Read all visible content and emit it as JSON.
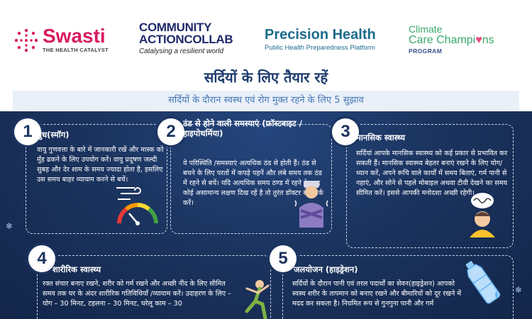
{
  "logos": {
    "swasti": {
      "name": "Swasti",
      "tagline": "THE HEALTH CATALYST"
    },
    "community_action_collab": {
      "line1": "COMMUNITY",
      "line2": "ACTIONCOLLAB",
      "tagline": "Catalysing a resilient world"
    },
    "precision_health": {
      "name": "Precision Health",
      "tagline": "Public Health Preparedness Platform"
    },
    "climate_care_champions": {
      "line1": "Climate",
      "line2a": "Care Champi",
      "line2b": "ns",
      "line3": "PROGRAM"
    }
  },
  "title": "सर्दियों के लिए तैयार रहें",
  "subtitle": "सर्दियों के दौरान स्वस्थ एवं रोग मुक्त रहने के लिए 5 सुझाव",
  "tips": [
    {
      "number": "1",
      "title": "धुंध(स्मॉग)",
      "body": "वायु गुणवत्ता के बारे में जानकारी रखें और मास्क को मुँह ढकने के लिए उपयोग करें। वायु प्रदूषण जल्दी सुबह और देर शाम के समय ज्यादा होता है, इसलिए उस समय बाहर व्यायाम करने से बचें।"
    },
    {
      "number": "2",
      "title": "ठंड से होने वाली समस्याएं (फ्रॉस्टबाइट /हाइपोथर्मिया)",
      "body": "ये परिस्थिति /समस्याएं अत्यधिक ठंड से होती हैं। ठंड से बचने के लिए परतों में कपड़े पहनें और लंबे समय तक ठंड में रहने से बचें। यदि अत्यधिक समय ठण्ड में रहने के बाद कोई असामान्य लक्षण दिख रहें है तो तुरंत डॉक्टर से संपर्क करें।"
    },
    {
      "number": "3",
      "title": "मानसिक स्वास्थ्य",
      "body": "सर्दियां आपके मानसिक स्वास्थ्य को कई प्रकार से प्रभावित कर सकती हैं। मानसिक स्वास्थ्य बेहतर बनाएं रखने के लिए योग/ध्यान करें, अपने रूचि वाले कार्यों में समय बिताएं, गर्म पानी से नहाएं, और सोने से पहले मोबाइल अथवा टीवी देखने का समय सीमित करें। इससे आपकी मनोदशा अच्छी रहेगी।"
    },
    {
      "number": "4",
      "title": "शारीरिक स्वास्थ्य",
      "body": "रक्त संचार बनाए रखने, शरीर को गर्म रखने और अच्छी नींद के लिए सीमित समय तक घर के अंदर शारीरिक गतिविधियाँ /व्यायाम करें। उदाहरण के लिए – योग – 30 मिनट, टहलना – 30 मिनट, घरेलू काम – 30"
    },
    {
      "number": "5",
      "title": "जलयोजन (हाइड्रेशन)",
      "body": "सर्दियों के दौरान पानी एवं तरल पदार्थों का सेवन(हाइड्रेशन) आपको स्वस्थ शरीर के तापमान को बनाए रखने और बीमारियों को दूर रखने में मदद कर सकता है। नियमित रूप से गुनगुना पानी और गर्म"
    }
  ],
  "icons": {
    "tip1": "air-quality-gauge-icon",
    "tip2": "shivering-person-icon",
    "tip3": "stressed-person-icon",
    "tip4": "exercising-person-icon",
    "tip5": "water-bottle-icon"
  }
}
